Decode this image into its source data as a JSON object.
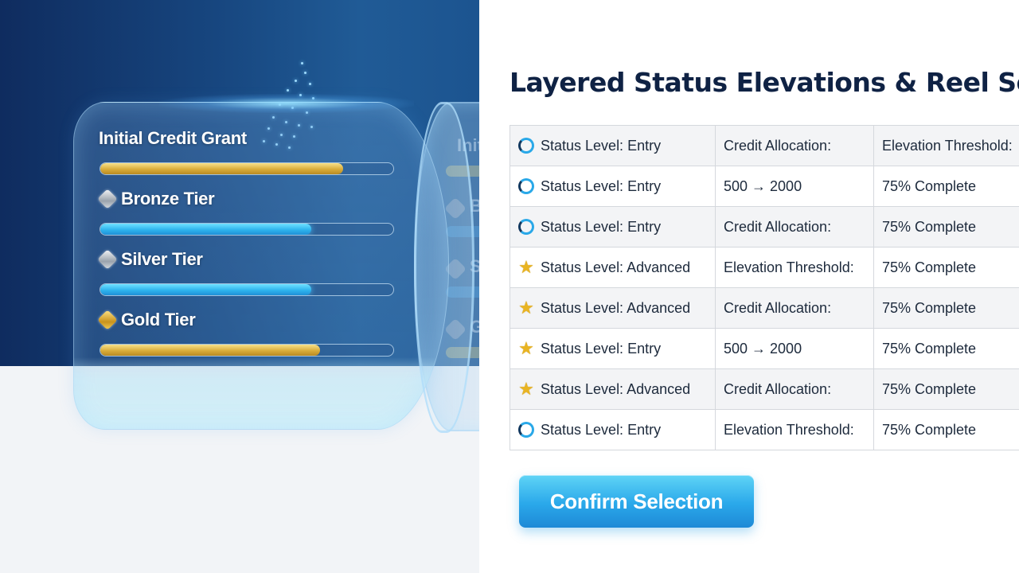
{
  "reel": {
    "tiers": [
      {
        "label": "Initial Credit Grant",
        "icon": "none",
        "bar_style": "gold",
        "progress": 0.83
      },
      {
        "label": "Bronze Tier",
        "icon": "silver-gem-icon",
        "bar_style": "blue",
        "progress": 0.72
      },
      {
        "label": "Silver Tier",
        "icon": "silver-gem-icon",
        "bar_style": "blue",
        "progress": 0.72
      },
      {
        "label": "Gold Tier",
        "icon": "gold-gem-icon",
        "bar_style": "gold",
        "progress": 0.75
      }
    ],
    "ghost_labels": [
      "Init",
      "B",
      "S",
      "G"
    ]
  },
  "page": {
    "title": "Layered Status Elevations & Reel Selecation"
  },
  "table": {
    "rows": [
      {
        "icon": "ring-icon",
        "status": "Status Level: Entry",
        "detail": "Credit Allocation:",
        "progress": "Elevation Threshold:"
      },
      {
        "icon": "ring-icon",
        "status": "Status Level: Entry",
        "detail": "500  → 2000",
        "progress": "75% Complete"
      },
      {
        "icon": "ring-icon",
        "status": "Status Level: Entry",
        "detail": "Credit Allocation:",
        "progress": "75% Complete"
      },
      {
        "icon": "star-icon",
        "status": "Status Level: Advanced",
        "detail": "Elevation Threshold:",
        "progress": "75% Complete"
      },
      {
        "icon": "star-icon",
        "status": "Status Level: Advanced",
        "detail": "Credit Allocation:",
        "progress": "75% Complete"
      },
      {
        "icon": "star-icon",
        "status": "Status Level: Entry",
        "detail": "500 → 2000",
        "progress": "75% Complete"
      },
      {
        "icon": "star-icon",
        "status": "Status Level: Advanced",
        "detail": "Credit Allocation:",
        "progress": "75% Complete"
      },
      {
        "icon": "ring-icon",
        "status": "Status Level: Entry",
        "detail": "Elevation Threshold:",
        "progress": "75% Complete"
      }
    ]
  },
  "actions": {
    "confirm_label": "Confirm Selection"
  },
  "colors": {
    "accent": "#2aa8ea",
    "title": "#0f2244",
    "gold": "#d9ad3a",
    "panel_dark": "#0f2c5f"
  }
}
